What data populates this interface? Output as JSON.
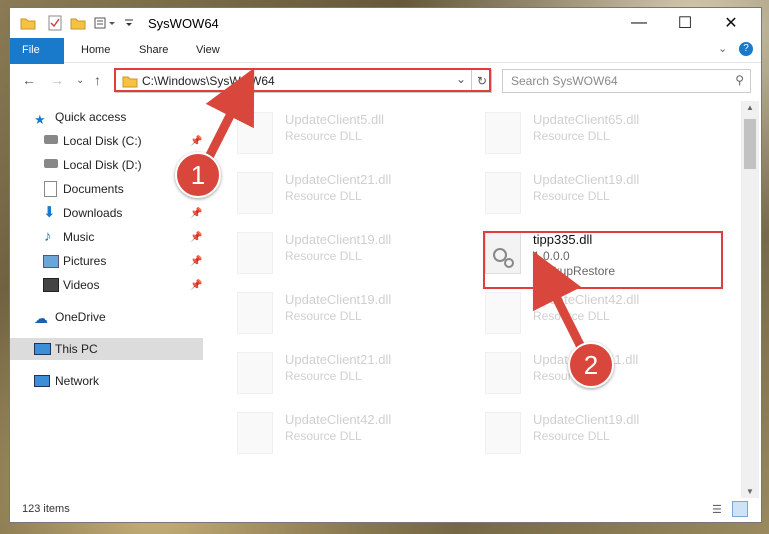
{
  "window": {
    "title": "SysWOW64"
  },
  "ribbon": {
    "tabs": [
      "File",
      "Home",
      "Share",
      "View"
    ]
  },
  "address": {
    "path": "C:\\Windows\\SysWOW64",
    "search_placeholder": "Search SysWOW64"
  },
  "nav": {
    "items": [
      {
        "label": "Quick access",
        "icon": "star-icon",
        "pinned": false
      },
      {
        "label": "Local Disk (C:)",
        "icon": "drive-icon",
        "pinned": true
      },
      {
        "label": "Local Disk (D:)",
        "icon": "drive-icon",
        "pinned": false
      },
      {
        "label": "Documents",
        "icon": "documents-icon",
        "pinned": false
      },
      {
        "label": "Downloads",
        "icon": "download-icon",
        "pinned": true
      },
      {
        "label": "Music",
        "icon": "music-icon",
        "pinned": true
      },
      {
        "label": "Pictures",
        "icon": "pictures-icon",
        "pinned": true
      },
      {
        "label": "Videos",
        "icon": "videos-icon",
        "pinned": true
      },
      {
        "label": "OneDrive",
        "icon": "cloud-icon",
        "pinned": false
      },
      {
        "label": "This PC",
        "icon": "computer-icon",
        "pinned": false
      },
      {
        "label": "Network",
        "icon": "network-icon",
        "pinned": false
      }
    ]
  },
  "files": {
    "left": [
      {
        "name": "UpdateClient5.dll",
        "type": "Resource DLL"
      },
      {
        "name": "UpdateClient21.dll",
        "type": "Resource DLL"
      },
      {
        "name": "UpdateClient19.dll",
        "type": "Resource DLL"
      },
      {
        "name": "UpdateClient19.dll",
        "type": "Resource DLL"
      },
      {
        "name": "UpdateClient21.dll",
        "type": "Resource DLL"
      },
      {
        "name": "UpdateClient42.dll",
        "type": "Resource DLL"
      }
    ],
    "right": [
      {
        "name": "UpdateClient65.dll",
        "type": "Resource DLL"
      },
      {
        "name": "UpdateClient19.dll",
        "type": "Resource DLL"
      },
      {
        "name": "UpdateClient42.dll",
        "type": "Resource DLL"
      },
      {
        "name": "UpdateClient11.dll",
        "type": "Resource DLL"
      },
      {
        "name": "UpdateClient19.dll",
        "type": "Resource DLL"
      }
    ],
    "selected": {
      "name": "tipp335.dll",
      "version": "1.0.0.0",
      "description": "BackupRestore"
    }
  },
  "status": {
    "items": "123 items"
  },
  "badges": {
    "one": "1",
    "two": "2"
  },
  "colors": {
    "highlight": "#e23d3d",
    "accent": "#1979ca"
  }
}
